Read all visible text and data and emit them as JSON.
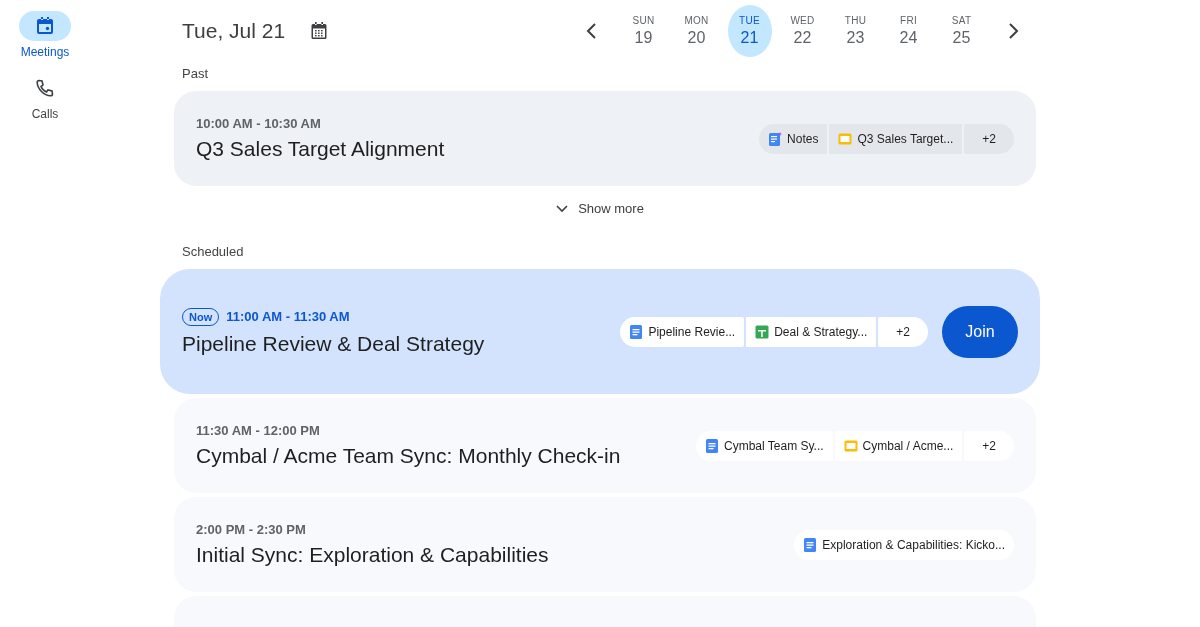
{
  "sidebar": {
    "items": [
      {
        "kind": "meetings",
        "label": "Meetings",
        "selected": true
      },
      {
        "kind": "calls",
        "label": "Calls",
        "selected": false
      }
    ]
  },
  "header": {
    "date": "Tue, Jul 21"
  },
  "week": {
    "days": [
      {
        "weekday": "SUN",
        "day": "19",
        "selected": false
      },
      {
        "weekday": "MON",
        "day": "20",
        "selected": false
      },
      {
        "weekday": "TUE",
        "day": "21",
        "selected": true
      },
      {
        "weekday": "WED",
        "day": "22",
        "selected": false
      },
      {
        "weekday": "THU",
        "day": "23",
        "selected": false
      },
      {
        "weekday": "FRI",
        "day": "24",
        "selected": false
      },
      {
        "weekday": "SAT",
        "day": "25",
        "selected": false
      }
    ]
  },
  "sections": [
    {
      "heading": "Past",
      "show_more": "Show more",
      "meetings": [
        {
          "kind": "past",
          "time": "10:00 AM - 10:30 AM",
          "title": "Q3 Sales Target Alignment",
          "attachments": [
            {
              "kind": "notes",
              "label": "Notes"
            },
            {
              "kind": "slides",
              "label": "Q3 Sales Target..."
            }
          ],
          "more": "+2"
        }
      ]
    },
    {
      "heading": "Scheduled",
      "meetings": [
        {
          "kind": "now",
          "badge": "Now",
          "time": "11:00 AM - 11:30 AM",
          "title": "Pipeline Review & Deal Strategy",
          "attachments": [
            {
              "kind": "docs",
              "label": "Pipeline Revie..."
            },
            {
              "kind": "sheets",
              "label": "Deal & Strategy..."
            }
          ],
          "more": "+2",
          "join": "Join"
        },
        {
          "kind": "upcoming",
          "time": "11:30 AM - 12:00 PM",
          "title": "Cymbal / Acme Team Sync: Monthly Check-in",
          "attachments": [
            {
              "kind": "docs",
              "label": "Cymbal Team Sy..."
            },
            {
              "kind": "slides",
              "label": "Cymbal / Acme..."
            }
          ],
          "more": "+2"
        },
        {
          "kind": "upcoming",
          "time": "2:00 PM - 2:30 PM",
          "title": "Initial Sync: Exploration & Capabilities",
          "attachments": [
            {
              "kind": "docs",
              "label": "Exploration & Capabilities: Kicko..."
            }
          ]
        },
        {
          "kind": "clipped"
        }
      ]
    }
  ]
}
